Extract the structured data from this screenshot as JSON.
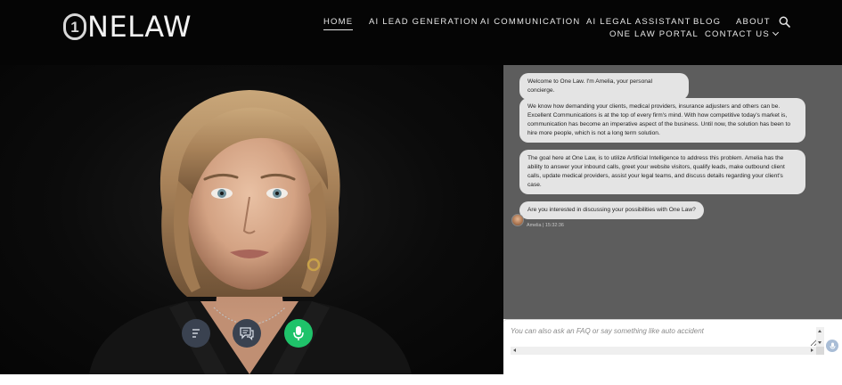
{
  "brand": {
    "logo_mark": "1",
    "logo_text": "NELAW"
  },
  "nav": {
    "row1": [
      "HOME",
      "AI LEAD GENERATION",
      "AI COMMUNICATION",
      "AI LEGAL ASSISTANT",
      "BLOG",
      "ABOUT"
    ],
    "row2": [
      "ONE LAW PORTAL",
      "CONTACT US"
    ],
    "active": "HOME",
    "search_icon": "search-icon",
    "dropdown_icon": "chevron-down-icon"
  },
  "controls": {
    "menu_icon": "menu-lines-icon",
    "chat_icon": "chat-bubbles-icon",
    "mic_icon": "microphone-icon",
    "mic_color": "#1fc36a"
  },
  "chat": {
    "messages": [
      "Welcome to One Law. I'm Amelia, your personal concierge.",
      "We know how demanding your clients, medical providers, insurance adjusters and others can be. Excellent Communications is at the top of every firm's mind. With how competitive today's market is, communication has become an imperative aspect of the business. Until now, the solution has been to hire more people, which is not a long term solution.",
      "The goal here at One Law, is to utilize Artificial Intelligence to address this problem. Amelia has the ability to answer your inbound calls, greet your website visitors, qualify leads, make outbound client calls, update medical providers, assist your legal teams, and discuss details regarding your client's case.",
      "Are you interested in discussing your possibilities with One Law?"
    ],
    "meta": "Amelia | 15:32:36",
    "input_placeholder": "You can also ask an FAQ or say something like auto accident",
    "panel_color": "#5d5d5d",
    "bubble_color": "#e4e4e4"
  }
}
